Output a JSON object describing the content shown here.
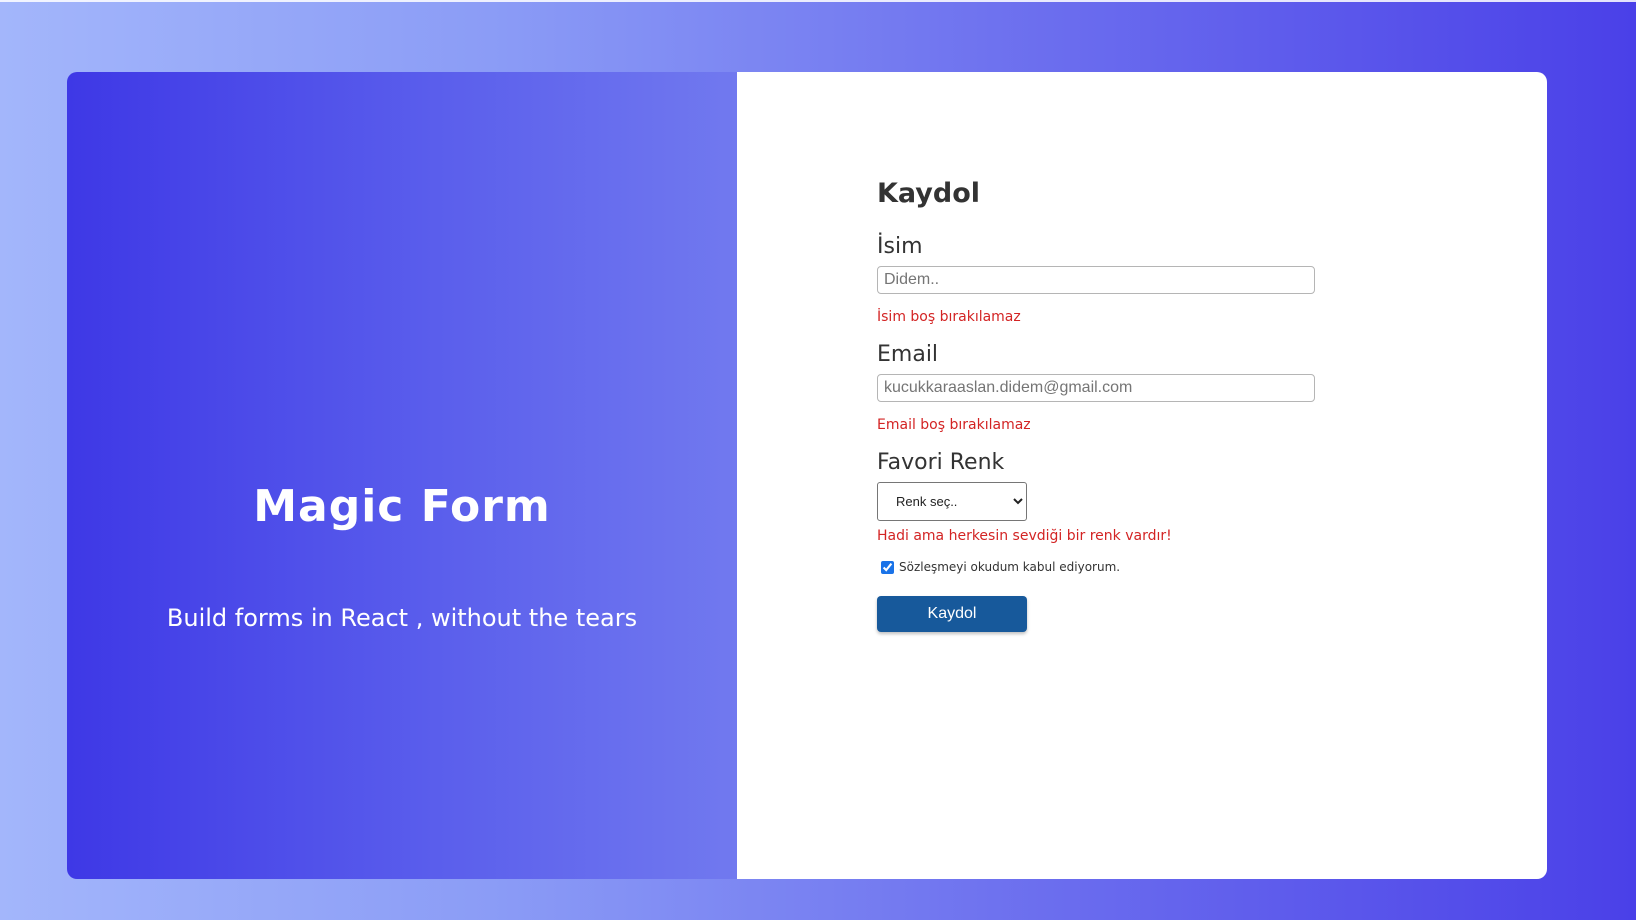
{
  "hero": {
    "title": "Magic Form",
    "subtitle": "Build forms in React , without the tears"
  },
  "form": {
    "title": "Kaydol",
    "name_field": {
      "label": "İsim",
      "placeholder": "Didem..",
      "value": "",
      "error": "İsim boş bırakılamaz"
    },
    "email_field": {
      "label": "Email",
      "placeholder": "kucukkaraaslan.didem@gmail.com",
      "value": "",
      "error": "Email boş bırakılamaz"
    },
    "color_field": {
      "label": "Favori Renk",
      "selected": "Renk seç..",
      "error": "Hadi ama herkesin sevdiği bir renk vardır!"
    },
    "agreement": {
      "label": "Sözleşmeyi okudum kabul ediyorum.",
      "checked": true
    },
    "submit_label": "Kaydol"
  },
  "colors": {
    "hero_gradient_start": "#3e38e6",
    "hero_gradient_end": "#7179ef",
    "error": "#d32424",
    "button": "#17599b"
  }
}
